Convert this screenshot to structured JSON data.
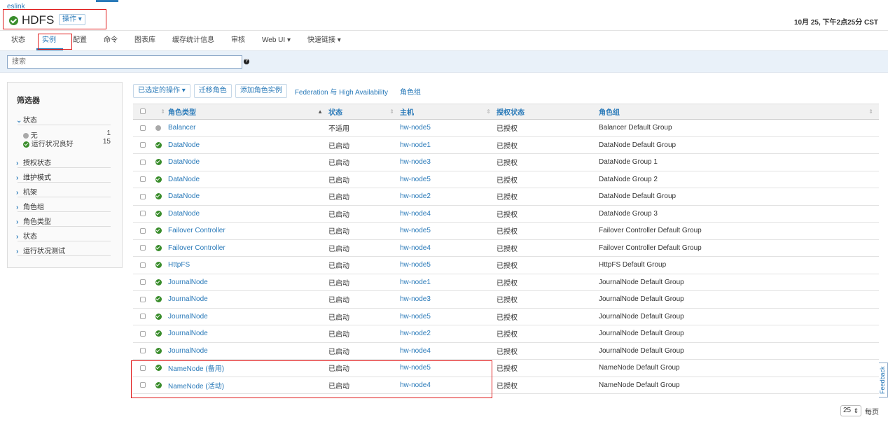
{
  "cluster_link": "eslink",
  "service": {
    "title": "HDFS",
    "actions_label": "操作 ▾",
    "timestamp": "10月 25, 下午2点25分 CST"
  },
  "tabs": [
    {
      "label": "状态",
      "active": false
    },
    {
      "label": "实例",
      "active": true
    },
    {
      "label": "配置",
      "active": false
    },
    {
      "label": "命令",
      "active": false
    },
    {
      "label": "图表库",
      "active": false
    },
    {
      "label": "缓存统计信息",
      "active": false
    },
    {
      "label": "审核",
      "active": false
    },
    {
      "label": "Web UI ▾",
      "active": false
    },
    {
      "label": "快速链接 ▾",
      "active": false
    }
  ],
  "search": {
    "placeholder": "搜索",
    "help_icon": "question-circle-icon"
  },
  "filters": {
    "title": "筛选器",
    "status_section": "状态",
    "status_items": [
      {
        "label": "无",
        "count": "1",
        "icon": "gray-dot-icon"
      },
      {
        "label": "运行状况良好",
        "count": "15",
        "icon": "check-circle-icon"
      }
    ],
    "sections": [
      "授权状态",
      "维护模式",
      "机架",
      "角色组",
      "角色类型",
      "状态",
      "运行状况测试"
    ]
  },
  "toolbar": {
    "selected_actions": "已选定的操作 ▾",
    "migrate_roles": "迁移角色",
    "add_role_instances": "添加角色实例",
    "federation_ha": "Federation 与 High Availability",
    "role_groups": "角色组"
  },
  "table": {
    "headers": [
      "角色类型",
      "状态",
      "主机",
      "授权状态",
      "角色组"
    ],
    "rows": [
      {
        "type": "Balancer",
        "status": "不适用",
        "host": "hw-node5",
        "auth": "已授权",
        "group": "Balancer Default Group",
        "health": "none"
      },
      {
        "type": "DataNode",
        "status": "已启动",
        "host": "hw-node1",
        "auth": "已授权",
        "group": "DataNode Default Group",
        "health": "good"
      },
      {
        "type": "DataNode",
        "status": "已启动",
        "host": "hw-node3",
        "auth": "已授权",
        "group": "DataNode Group 1",
        "health": "good"
      },
      {
        "type": "DataNode",
        "status": "已启动",
        "host": "hw-node5",
        "auth": "已授权",
        "group": "DataNode Group 2",
        "health": "good"
      },
      {
        "type": "DataNode",
        "status": "已启动",
        "host": "hw-node2",
        "auth": "已授权",
        "group": "DataNode Default Group",
        "health": "good"
      },
      {
        "type": "DataNode",
        "status": "已启动",
        "host": "hw-node4",
        "auth": "已授权",
        "group": "DataNode Group 3",
        "health": "good"
      },
      {
        "type": "Failover Controller",
        "status": "已启动",
        "host": "hw-node5",
        "auth": "已授权",
        "group": "Failover Controller Default Group",
        "health": "good"
      },
      {
        "type": "Failover Controller",
        "status": "已启动",
        "host": "hw-node4",
        "auth": "已授权",
        "group": "Failover Controller Default Group",
        "health": "good"
      },
      {
        "type": "HttpFS",
        "status": "已启动",
        "host": "hw-node5",
        "auth": "已授权",
        "group": "HttpFS Default Group",
        "health": "good"
      },
      {
        "type": "JournalNode",
        "status": "已启动",
        "host": "hw-node1",
        "auth": "已授权",
        "group": "JournalNode Default Group",
        "health": "good"
      },
      {
        "type": "JournalNode",
        "status": "已启动",
        "host": "hw-node3",
        "auth": "已授权",
        "group": "JournalNode Default Group",
        "health": "good"
      },
      {
        "type": "JournalNode",
        "status": "已启动",
        "host": "hw-node5",
        "auth": "已授权",
        "group": "JournalNode Default Group",
        "health": "good"
      },
      {
        "type": "JournalNode",
        "status": "已启动",
        "host": "hw-node2",
        "auth": "已授权",
        "group": "JournalNode Default Group",
        "health": "good"
      },
      {
        "type": "JournalNode",
        "status": "已启动",
        "host": "hw-node4",
        "auth": "已授权",
        "group": "JournalNode Default Group",
        "health": "good"
      },
      {
        "type": "NameNode (备用)",
        "status": "已启动",
        "host": "hw-node5",
        "auth": "已授权",
        "group": "NameNode Default Group",
        "health": "good"
      },
      {
        "type": "NameNode (活动)",
        "status": "已启动",
        "host": "hw-node4",
        "auth": "已授权",
        "group": "NameNode Default Group",
        "health": "good"
      }
    ]
  },
  "feedback_label": "Feedback",
  "pager": {
    "page_size": "25",
    "per_page_label": "每页"
  },
  "colors": {
    "accent": "#2a7ab9",
    "good": "#3a8d2c",
    "highlight": "#e01b1b"
  }
}
